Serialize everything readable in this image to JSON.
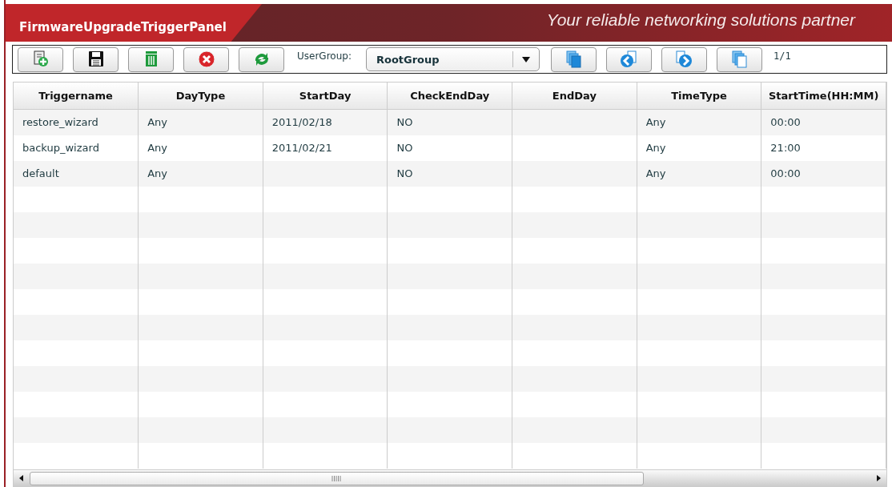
{
  "header": {
    "title": "FirmwareUpgradeTriggerPanel",
    "tagline": "Your reliable networking solutions partner"
  },
  "toolbar": {
    "user_group_label": "UserGroup:",
    "user_group": "RootGroup",
    "page": "1/1"
  },
  "table": {
    "columns": [
      "Triggername",
      "DayType",
      "StartDay",
      "CheckEndDay",
      "EndDay",
      "TimeType",
      "StartTime(HH:MM)"
    ],
    "rows": [
      [
        "restore_wizard",
        "Any",
        "2011/02/18",
        "NO",
        "",
        "Any",
        "00:00"
      ],
      [
        "backup_wizard",
        "Any",
        "2011/02/21",
        "NO",
        "",
        "Any",
        "21:00"
      ],
      [
        "default",
        "Any",
        "",
        "NO",
        "",
        "Any",
        "00:00"
      ]
    ]
  }
}
